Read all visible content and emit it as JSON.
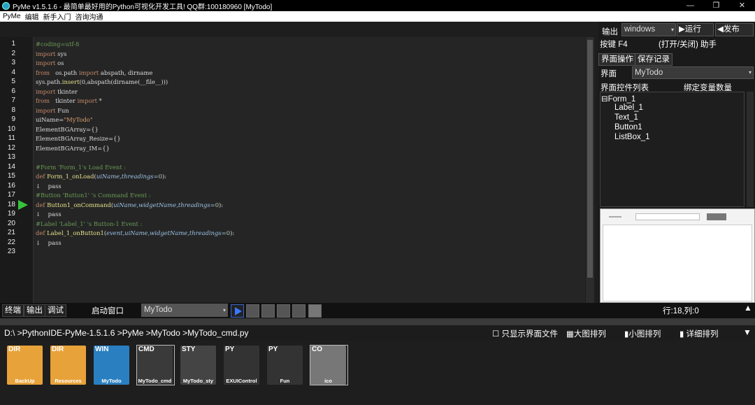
{
  "titlebar": {
    "title": "PyMe v1.5.1.6 - 最简单最好用的Python可视化开发工具! QQ群:100180960    [MyTodo]",
    "minimize": "—",
    "maximize": "❐",
    "close": "✕"
  },
  "menu": [
    "PyMe",
    "编辑",
    "新手入门",
    "咨询沟通"
  ],
  "editor": {
    "line_numbers": [
      "1",
      "2",
      "3",
      "4",
      "5",
      "6",
      "7",
      "8",
      "9",
      "10",
      "11",
      "12",
      "13",
      "14",
      "15",
      "16",
      "17",
      "18",
      "19",
      "20",
      "21",
      "22",
      "23"
    ],
    "current_line": 18,
    "lines": [
      [
        {
          "t": "#coding=utf-8",
          "c": "comment"
        }
      ],
      [
        {
          "t": "import",
          "c": "kw"
        },
        {
          "t": " sys",
          "c": "var"
        }
      ],
      [
        {
          "t": "import",
          "c": "kw"
        },
        {
          "t": " os",
          "c": "var"
        }
      ],
      [
        {
          "t": "from",
          "c": "kw"
        },
        {
          "t": "   os.path ",
          "c": "var"
        },
        {
          "t": "import",
          "c": "kw"
        },
        {
          "t": " abspath, dirname",
          "c": "var"
        }
      ],
      [
        {
          "t": "sys.path.",
          "c": "var"
        },
        {
          "t": "insert",
          "c": "fn"
        },
        {
          "t": "(0,abspath(dirname(__file__)))",
          "c": "var"
        }
      ],
      [
        {
          "t": "import",
          "c": "kw"
        },
        {
          "t": " tkinter",
          "c": "var"
        }
      ],
      [
        {
          "t": "from",
          "c": "kw"
        },
        {
          "t": "   tkinter ",
          "c": "var"
        },
        {
          "t": "import",
          "c": "kw"
        },
        {
          "t": " *",
          "c": "var"
        }
      ],
      [
        {
          "t": "import",
          "c": "kw"
        },
        {
          "t": " Fun",
          "c": "var"
        }
      ],
      [
        {
          "t": "uiName=",
          "c": "var"
        },
        {
          "t": "\"MyTodo\"",
          "c": "str"
        }
      ],
      [
        {
          "t": "ElementBGArray={}",
          "c": "var"
        }
      ],
      [
        {
          "t": "ElementBGArray_Resize={}",
          "c": "var"
        }
      ],
      [
        {
          "t": "ElementBGArray_IM={}",
          "c": "var"
        }
      ],
      [],
      [
        {
          "t": "#Form 'Form_1's Load Event :",
          "c": "comment"
        }
      ],
      [
        {
          "t": "def",
          "c": "kw"
        },
        {
          "t": " Form_1_onLoad",
          "c": "fn"
        },
        {
          "t": "(",
          "c": "var"
        },
        {
          "t": "uiName,threadings=",
          "c": "arg"
        },
        {
          "t": "0",
          "c": "num"
        },
        {
          "t": "):",
          "c": "var"
        }
      ],
      [
        {
          "t": "↓    pass",
          "c": "var"
        }
      ],
      [
        {
          "t": "#Button 'Button1' 's Command Event :",
          "c": "comment"
        }
      ],
      [
        {
          "t": "def",
          "c": "kw"
        },
        {
          "t": " Button1_onCommand",
          "c": "fn"
        },
        {
          "t": "(",
          "c": "var"
        },
        {
          "t": "uiName,widgetName,threadings=",
          "c": "arg"
        },
        {
          "t": "0",
          "c": "num"
        },
        {
          "t": "):",
          "c": "var"
        }
      ],
      [
        {
          "t": "↓    pass",
          "c": "var"
        }
      ],
      [
        {
          "t": "#Label 'Label_1' 's Button-1 Event :",
          "c": "comment"
        }
      ],
      [
        {
          "t": "def",
          "c": "kw"
        },
        {
          "t": " Label_1_onButton1",
          "c": "fn"
        },
        {
          "t": "(",
          "c": "var"
        },
        {
          "t": "event,uiName,widgetName,threadings=",
          "c": "arg"
        },
        {
          "t": "0",
          "c": "num"
        },
        {
          "t": "):",
          "c": "var"
        }
      ],
      [
        {
          "t": "↓    pass",
          "c": "var"
        }
      ],
      []
    ]
  },
  "right": {
    "output_label": "输出",
    "platform": "windows",
    "run_label": "▶运行",
    "publish_label": "◀发布",
    "hotkey": "按键 F4",
    "hotkey_desc": "(打开/关闭) 助手",
    "tab_ops": "界面操作",
    "tab_save": "保存记录",
    "ui_label": "界面",
    "ui_value": "MyTodo",
    "controls_label": "界面控件列表",
    "bind_label": "绑定变量数量",
    "tree": [
      "⊟Form_1",
      "Label_1",
      "Text_1",
      "Button1",
      "ListBox_1"
    ]
  },
  "bottom": {
    "tabs": [
      "终端",
      "输出",
      "调试"
    ],
    "start_window_label": "启动窗口",
    "start_window_value": "MyTodo",
    "status": "行:18,列:0",
    "path": "D:\\ >PythonIDE-PyMe-1.5.1.6 >PyMe >MyTodo >MyTodo_cmd.py",
    "only_ui": "只显示界面文件",
    "large": "大图排列",
    "small": "小图排列",
    "detail": "详细排列"
  },
  "files": [
    {
      "type": "DIR",
      "name": "BackUp",
      "color": "#e8a23a"
    },
    {
      "type": "DIR",
      "name": "Resources",
      "color": "#e8a23a"
    },
    {
      "type": "WIN",
      "name": "MyTodo",
      "color": "#2a7fc0"
    },
    {
      "type": "CMD",
      "name": "MyTodo_cmd",
      "color": "#3a3a3a"
    },
    {
      "type": "STY",
      "name": "MyTodo_sty",
      "color": "#444"
    },
    {
      "type": "PY",
      "name": "EXUIControl",
      "color": "#333"
    },
    {
      "type": "PY",
      "name": "Fun",
      "color": "#333"
    },
    {
      "type": "CO",
      "name": "ico",
      "color": "#777"
    }
  ]
}
